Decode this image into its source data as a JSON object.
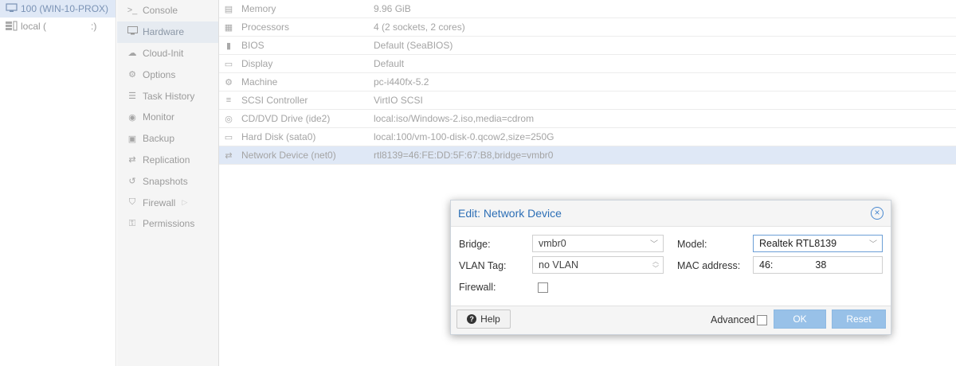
{
  "tree": {
    "items": [
      {
        "label": "100 (WIN-10-PROX)",
        "icon": "monitor-icon"
      },
      {
        "label": "local (",
        "suffix": ":)",
        "icon": "storage-icon"
      }
    ]
  },
  "nav": {
    "items": [
      {
        "label": "Console",
        "icon": "terminal-icon",
        "glyph": ">_"
      },
      {
        "label": "Hardware",
        "icon": "monitor-icon",
        "glyph": "🖵"
      },
      {
        "label": "Cloud-Init",
        "icon": "cloud-icon",
        "glyph": "☁"
      },
      {
        "label": "Options",
        "icon": "gear-icon",
        "glyph": "⚙"
      },
      {
        "label": "Task History",
        "icon": "list-icon",
        "glyph": "☰"
      },
      {
        "label": "Monitor",
        "icon": "eye-icon",
        "glyph": "◉"
      },
      {
        "label": "Backup",
        "icon": "floppy-icon",
        "glyph": "▣"
      },
      {
        "label": "Replication",
        "icon": "retweet-icon",
        "glyph": "⇄"
      },
      {
        "label": "Snapshots",
        "icon": "history-icon",
        "glyph": "↺"
      },
      {
        "label": "Firewall",
        "icon": "shield-icon",
        "glyph": "⛉"
      },
      {
        "label": "Permissions",
        "icon": "unlock-icon",
        "glyph": "🔓"
      }
    ]
  },
  "hardware": {
    "rows": [
      {
        "name": "Memory",
        "value": "9.96 GiB",
        "icon": "memory-icon",
        "glyph": "▤"
      },
      {
        "name": "Processors",
        "value": "4 (2 sockets, 2 cores)",
        "icon": "cpu-icon",
        "glyph": "▦"
      },
      {
        "name": "BIOS",
        "value": "Default (SeaBIOS)",
        "icon": "microchip-icon",
        "glyph": "▮"
      },
      {
        "name": "Display",
        "value": "Default",
        "icon": "desktop-icon",
        "glyph": "▭"
      },
      {
        "name": "Machine",
        "value": "pc-i440fx-5.2",
        "icon": "cogs-icon",
        "glyph": "⚙"
      },
      {
        "name": "SCSI Controller",
        "value": "VirtIO SCSI",
        "icon": "database-icon",
        "glyph": "≡"
      },
      {
        "name": "CD/DVD Drive (ide2)",
        "value": "local:iso/Windows-2.iso,media=cdrom",
        "icon": "cdrom-icon",
        "glyph": "◎"
      },
      {
        "name": "Hard Disk (sata0)",
        "value": "local:100/vm-100-disk-0.qcow2,size=250G",
        "icon": "hdd-icon",
        "glyph": "▭"
      },
      {
        "name": "Network Device (net0)",
        "value": "rtl8139=46:FE:DD:5F:67:B8,bridge=vmbr0",
        "icon": "exchange-icon",
        "glyph": "⇄"
      }
    ]
  },
  "dialog": {
    "title": "Edit: Network Device",
    "bridge_label": "Bridge:",
    "bridge_value": "vmbr0",
    "vlan_label": "VLAN Tag:",
    "vlan_value": "no VLAN",
    "firewall_label": "Firewall:",
    "model_label": "Model:",
    "model_value": "Realtek RTL8139",
    "mac_label": "MAC address:",
    "mac_value_start": "46:",
    "mac_value_end": "38",
    "help_label": "Help",
    "advanced_label": "Advanced",
    "ok_label": "OK",
    "reset_label": "Reset"
  }
}
